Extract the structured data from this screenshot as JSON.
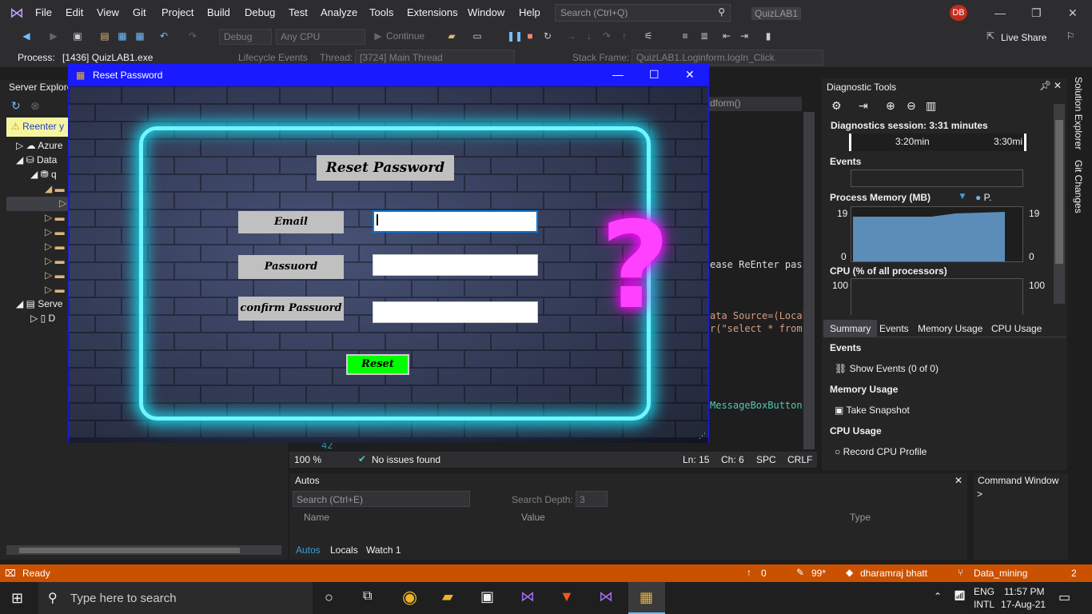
{
  "vs": {
    "menu": [
      "File",
      "Edit",
      "View",
      "Git",
      "Project",
      "Build",
      "Debug",
      "Test",
      "Analyze",
      "Tools",
      "Extensions",
      "Window",
      "Help"
    ],
    "search_placeholder": "Search (Ctrl+Q)",
    "solution_name": "QuizLAB1",
    "user_initials": "DB",
    "live_share": "Live Share",
    "config": "Debug",
    "platform": "Any CPU",
    "continue_label": "Continue",
    "process_label": "Process:",
    "process_value": "[1436] QuizLAB1.exe",
    "lifecycle_label": "Lifecycle Events",
    "thread_label": "Thread:",
    "thread_value": "[3724] Main Thread",
    "stackframe_label": "Stack Frame:",
    "stackframe_value": "QuizLAB1.Loginform.logIn_Click"
  },
  "server_explorer": {
    "title": "Server Explore",
    "reenter": "Reenter y",
    "tree": [
      "Azure",
      "Data",
      "q",
      "Serve",
      "D"
    ]
  },
  "code": {
    "nav_combo": "dform()",
    "lines": [
      "ease ReEnter pass",
      "ata Source=(Local",
      "r(\"select * from ",
      "MessageBoxButton"
    ],
    "line_number": "42",
    "zoom": "100 %",
    "issues": "No issues found",
    "ln": "Ln: 15",
    "ch": "Ch: 6",
    "spc": "SPC",
    "crlf": "CRLF"
  },
  "dialog": {
    "title": "Reset Password",
    "heading": "Reset Password",
    "email_label": "Email",
    "password_label": "Passuord",
    "confirm_label": "confirm Passuord",
    "email_value": "",
    "password_value": "",
    "confirm_value": "",
    "reset_button": "Reset"
  },
  "diagnostics": {
    "title": "Diagnostic Tools",
    "session": "Diagnostics session: 3:31 minutes",
    "time_left": "3:20min",
    "time_right": "3:30mi",
    "events_header": "Events",
    "memory_header": "Process Memory (MB)",
    "memory_legend": "P.",
    "mem_max_left": "19",
    "mem_min_left": "0",
    "mem_max_right": "19",
    "mem_min_right": "0",
    "cpu_header": "CPU (% of all processors)",
    "cpu_max_left": "100",
    "cpu_max_right": "100",
    "tabs": [
      "Summary",
      "Events",
      "Memory Usage",
      "CPU Usage"
    ],
    "sec_events": "Events",
    "show_events": "Show Events (0 of 0)",
    "sec_memory": "Memory Usage",
    "take_snapshot": "Take Snapshot",
    "sec_cpu": "CPU Usage",
    "record_cpu": "Record CPU Profile"
  },
  "side_tabs": [
    "Solution Explorer",
    "Git Changes"
  ],
  "autos": {
    "title": "Autos",
    "search_placeholder": "Search (Ctrl+E)",
    "search_depth_label": "Search Depth:",
    "search_depth": "3",
    "col_name": "Name",
    "col_value": "Value",
    "col_type": "Type",
    "tabs": [
      "Autos",
      "Locals",
      "Watch 1"
    ]
  },
  "command_window": {
    "title": "Command Window",
    "prompt": ">"
  },
  "statusbar": {
    "ready": "Ready",
    "up_count": "0",
    "pencil_count": "99*",
    "user": "dharamraj bhatt",
    "branch": "Data_mining",
    "notifications": "2"
  },
  "taskbar": {
    "search_placeholder": "Type here to search",
    "lang1": "ENG",
    "lang2": "INTL",
    "time": "11:57 PM",
    "date": "17-Aug-21"
  }
}
